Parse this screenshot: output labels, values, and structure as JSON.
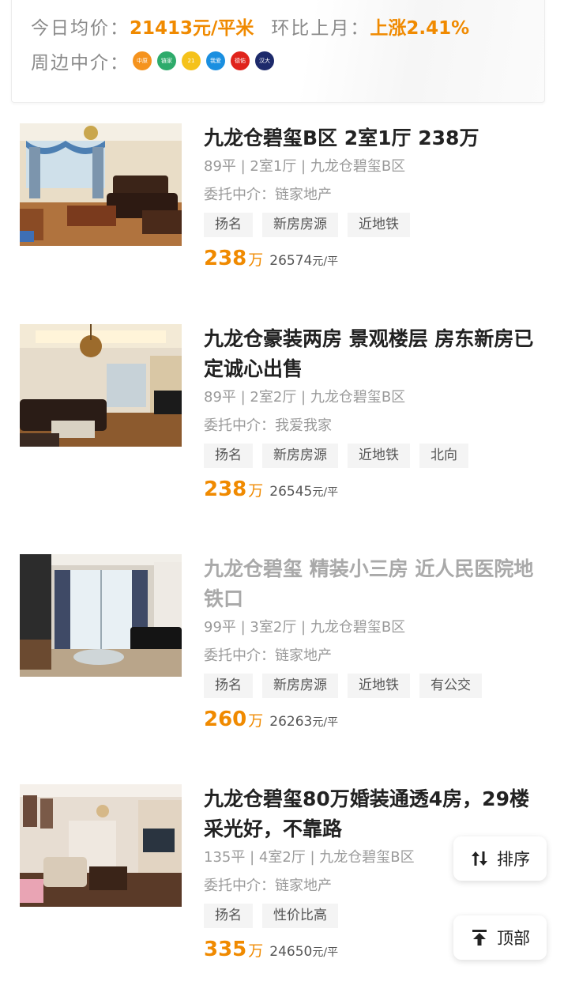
{
  "summary": {
    "avg_price_label": "今日均价：",
    "avg_price_value": "21413元/平米",
    "mom_label": "环比上月：",
    "mom_value": "上涨2.41%",
    "nearby_label": "周边中介：",
    "agencies": [
      {
        "name": "中原",
        "color": "#f5931e"
      },
      {
        "name": "链家",
        "color": "#2eab6b"
      },
      {
        "name": "21",
        "color": "#f5c21b"
      },
      {
        "name": "我爱",
        "color": "#1a8fe0"
      },
      {
        "name": "德佑",
        "color": "#e0231b"
      },
      {
        "name": "汉大",
        "color": "#1d2a6b"
      }
    ]
  },
  "listings": [
    {
      "title": "九龙仓碧玺B区 2室1厅 238万",
      "meta": "89平 | 2室1厅 | 九龙仓碧玺B区",
      "agent": "委托中介：链家地产",
      "tags": [
        "扬名",
        "新房房源",
        "近地铁"
      ],
      "price": "238",
      "price_unit": "万",
      "unit_price": "26574",
      "unit_suffix": "元/平"
    },
    {
      "title": "九龙仓豪装两房 景观楼层 房东新房已定诚心出售",
      "meta": "89平 | 2室2厅 | 九龙仓碧玺B区",
      "agent": "委托中介：我爱我家",
      "tags": [
        "扬名",
        "新房房源",
        "近地铁",
        "北向"
      ],
      "price": "238",
      "price_unit": "万",
      "unit_price": "26545",
      "unit_suffix": "元/平"
    },
    {
      "title": "九龙仓碧玺 精装小三房 近人民医院地铁口",
      "meta": "99平 | 3室2厅 | 九龙仓碧玺B区",
      "agent": "委托中介：链家地产",
      "tags": [
        "扬名",
        "新房房源",
        "近地铁",
        "有公交"
      ],
      "price": "260",
      "price_unit": "万",
      "unit_price": "26263",
      "unit_suffix": "元/平"
    },
    {
      "title": "九龙仓碧玺80万婚装通透4房，29楼采光好，不靠路",
      "meta": "135平 | 4室2厅 | 九龙仓碧玺B区",
      "agent": "委托中介：链家地产",
      "tags": [
        "扬名",
        "性价比高"
      ],
      "price": "335",
      "price_unit": "万",
      "unit_price": "24650",
      "unit_suffix": "元/平"
    }
  ],
  "float_buttons": {
    "sort_label": "排序",
    "top_label": "顶部"
  },
  "colors": {
    "accent": "#f08a00",
    "tag_bg": "#f4f4f4"
  }
}
